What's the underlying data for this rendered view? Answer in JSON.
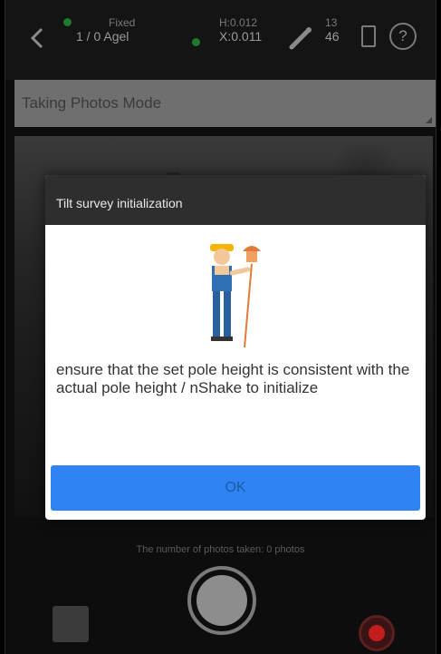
{
  "status_bar": {
    "satellite": {
      "label": "Fixed",
      "value": "1 / 0  Agel"
    },
    "rtk": {
      "label": "H:0.012",
      "value": "X:0.011"
    },
    "signal": {
      "label": "13",
      "value": "46"
    }
  },
  "mode_selector": {
    "label": "Taking Photos Mode"
  },
  "dialog": {
    "title": "Tilt survey initialization",
    "message": "ensure that the set pole height is consistent with the actual pole height / nShake to initialize",
    "ok_label": "OK"
  },
  "photo_count_text": "The number of photos taken: 0 photos",
  "icons": [
    "back-icon",
    "satellite-icon",
    "rtk-signal-icon",
    "pole-tool-icon",
    "battery-icon",
    "help-icon",
    "gallery-icon",
    "shutter-icon",
    "record-icon",
    "surveyor-illustration"
  ],
  "colors": {
    "ok_button": "#2f83f3",
    "dialog_header": "#2e2e2e",
    "record": "#c31e1e",
    "signal_green": "#1f7a2d"
  }
}
